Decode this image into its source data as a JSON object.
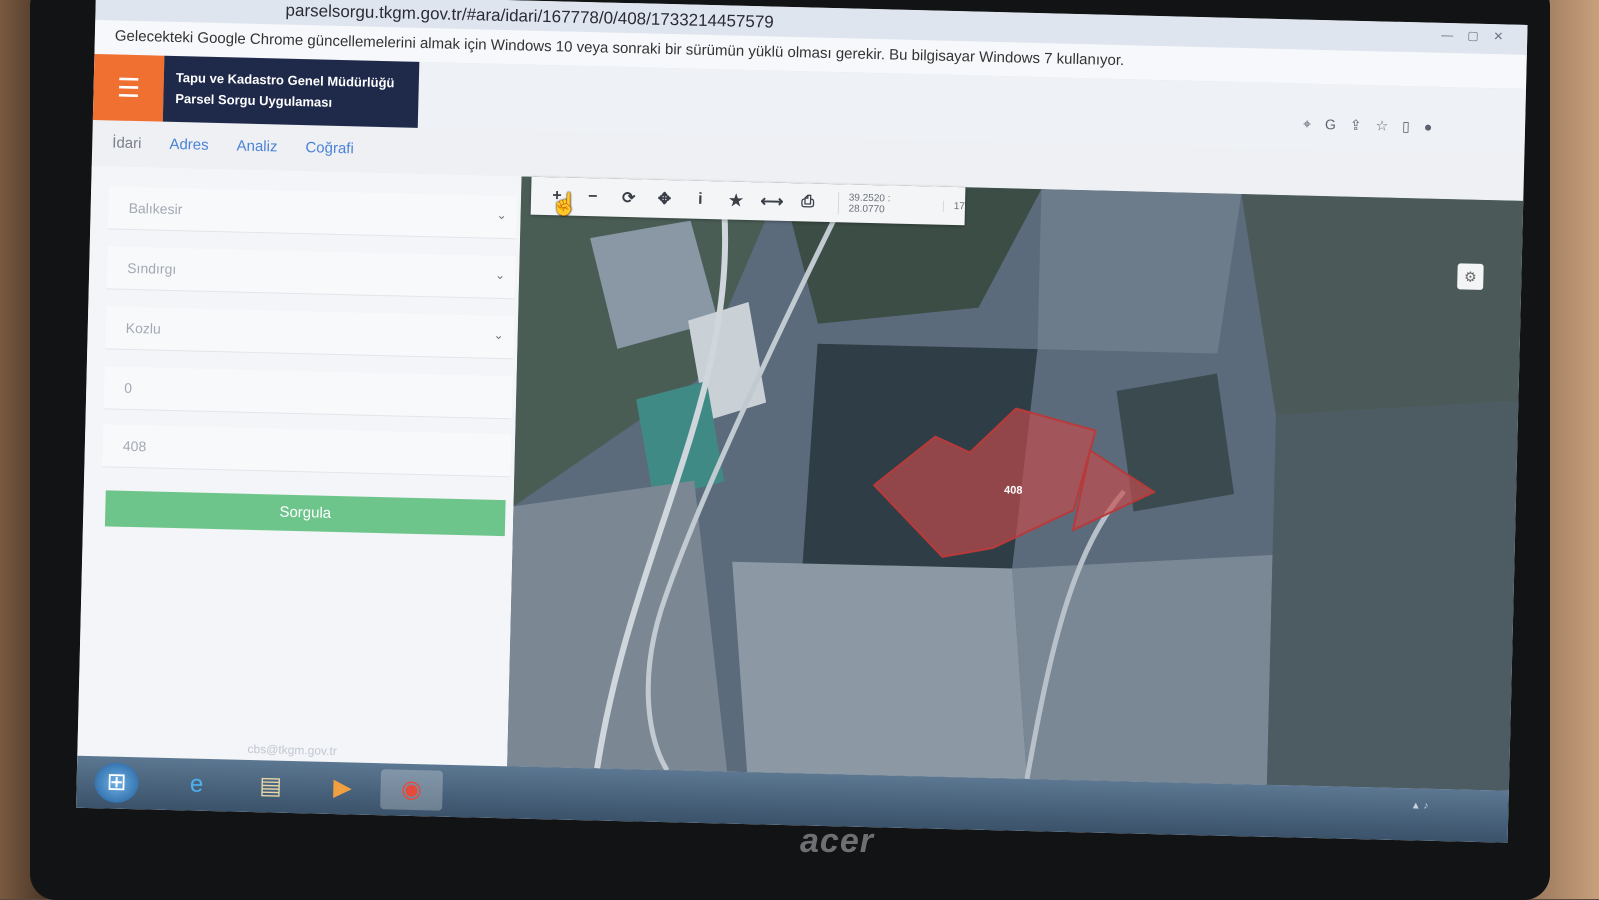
{
  "browser": {
    "url": "parselsorgu.tkgm.gov.tr/#ara/idari/167778/0/408/1733214457579",
    "info_message": "Gelecekteki Google Chrome güncellemelerini almak için Windows 10 veya sonraki bir sürümün yüklü olması gerekir. Bu bilgisayar Windows 7 kullanıyor."
  },
  "app": {
    "title_line1": "Tapu ve Kadastro Genel Müdürlüğü",
    "title_line2": "Parsel Sorgu Uygulaması",
    "menu_icon": "hamburger-icon"
  },
  "tabs": [
    {
      "label": "İdari",
      "active": true
    },
    {
      "label": "Adres"
    },
    {
      "label": "Analiz"
    },
    {
      "label": "Coğrafi"
    }
  ],
  "form": {
    "il": "Balıkesir",
    "ilce": "Sındırgı",
    "mahalle": "Kozlu",
    "ada": "0",
    "parsel": "408",
    "query_button": "Sorgula"
  },
  "footer_email": "cbs@tkgm.gov.tr",
  "map": {
    "coordinates": "39.2520 : 28.0770",
    "zoom": "17",
    "parcel_label": "408",
    "parcel_color": "#d9534f"
  },
  "taskbar": {
    "items": [
      "start-orb",
      "internet-explorer",
      "file-explorer",
      "media-player",
      "chrome"
    ]
  }
}
